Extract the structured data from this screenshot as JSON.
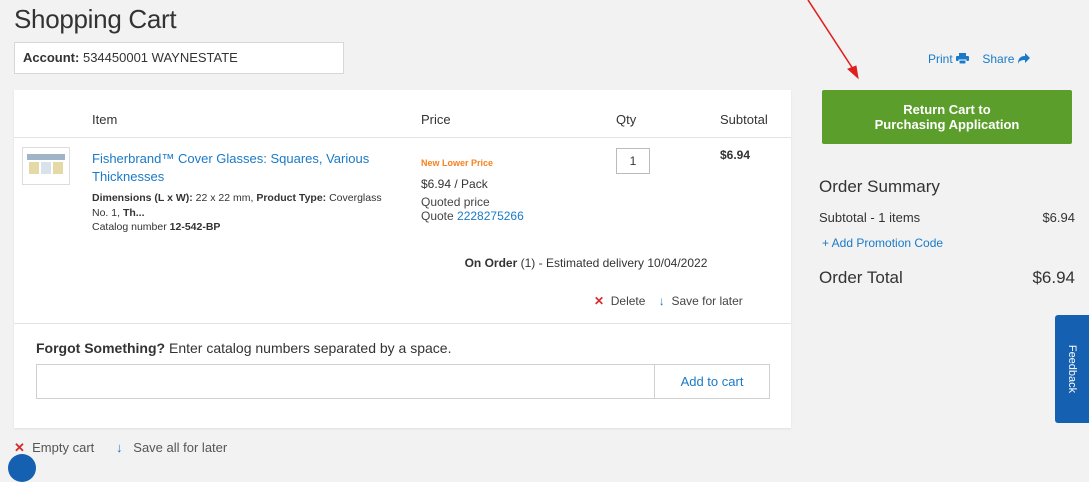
{
  "page": {
    "title": "Shopping Cart"
  },
  "account": {
    "label": "Account:",
    "value": "534450001 WAYNESTATE"
  },
  "tools": {
    "print": "Print",
    "share": "Share"
  },
  "cart": {
    "headers": {
      "item": "Item",
      "price": "Price",
      "qty": "Qty",
      "subtotal": "Subtotal"
    },
    "item": {
      "title": "Fisherbrand™ Cover Glasses: Squares, Various Thicknesses",
      "dims_label": "Dimensions (L x W):",
      "dims_value": " 22 x 22 mm, ",
      "type_label": "Product Type:",
      "type_value": " Coverglass No. 1, ",
      "more": "Th...",
      "catalog_label": "Catalog number ",
      "catalog_value": "12-542-BP",
      "badge": "New Lower Price",
      "price": "$6.94 / Pack",
      "quoted_price": "Quoted price",
      "quote_label": "Quote ",
      "quote_number": "2228275266",
      "qty": "1",
      "subtotal": "$6.94",
      "on_order_label": "On Order",
      "on_order_text": " (1) - Estimated delivery 10/04/2022",
      "delete": "Delete",
      "save_later": "Save for later"
    },
    "forgot": {
      "label": "Forgot Something?",
      "text": " Enter catalog numbers separated by a space.",
      "input_value": "",
      "button": "Add to cart"
    }
  },
  "bottom": {
    "empty": "Empty cart",
    "save_all": "Save all for later"
  },
  "summary": {
    "return_button_line1": "Return Cart to",
    "return_button_line2": "Purchasing Application",
    "title": "Order Summary",
    "subtotal_label": "Subtotal - 1 items",
    "subtotal_value": "$6.94",
    "promo": "+ Add Promotion Code",
    "total_label": "Order Total",
    "total_value": "$6.94"
  },
  "feedback": {
    "label": "Feedback"
  },
  "colors": {
    "accent_green": "#5b9e2b",
    "link_blue": "#1a7ac7",
    "badge_orange": "#f5821f",
    "feedback_blue": "#1560b0",
    "annotation_red": "#e02020"
  }
}
